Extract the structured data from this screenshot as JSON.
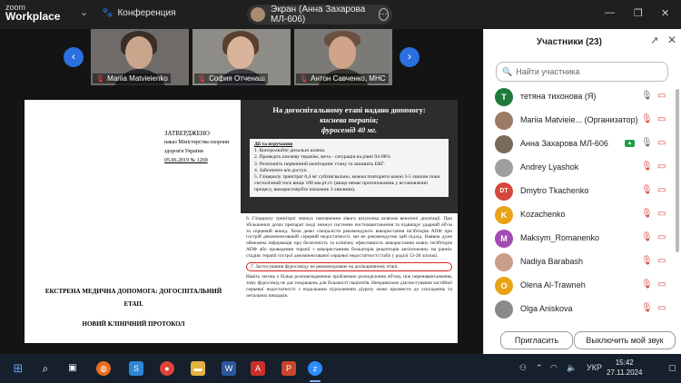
{
  "app": {
    "zoom_label": "zoom",
    "title": "Workplace",
    "meeting_name": "Конференция",
    "screen_share_label": "Экран (Анна Захарова МЛ-606)"
  },
  "icons": {
    "meeting": "paw-icon",
    "mic_off": "mic-off-icon",
    "video_off": "video-off-icon"
  },
  "colors": {
    "accent": "#2b6fe0",
    "mic_off": "#d6453c",
    "active_speaker": "#1f9e4a"
  },
  "video_strip": [
    {
      "name": "Mariia Matvieienko"
    },
    {
      "name": "София Отченаш"
    },
    {
      "name": "Антон Савченко, МНС"
    }
  ],
  "document": {
    "approve_heading": "ЗАТВЕРДЖЕНО",
    "approve_line1": "наказ Міністерства охорони",
    "approve_line2": "здоров'я України",
    "approve_date": "05.06.2019 № 1269",
    "title_line1": "ЕКСТРЕНА МЕДИЧНА ДОПОМОГА: ДОГОСПІТАЛЬНИЙ ЕТАП.",
    "title_line2": "НОВИЙ КЛІНІЧНИЙ ПРОТОКОЛ",
    "slide_heading1": "На догоспітальному етапі надано допомогу:",
    "slide_heading2": "киснева терапія;",
    "slide_heading3": "фуросемід 40 мг.",
    "steps_title": "Дії та втручання",
    "step1": "1. Контролюйте дихальні шляхи.",
    "step2": "2. Проведіть кисневу терапію, мета - сатурація на рівні 94-98%",
    "step3": "3. Розпочніть первинний моніторинг стану та запишіть ЕКГ.",
    "step4": "4. Забезпечте в/в доступ.",
    "step5": "5. Гліцерилу тринітрат 0,4 мг сублінгвально, можна повторити кожні 3-5 хвилин поки систолічний тиск вище 100 мм.рт.ст. (якщо немає протипоказань у встановленні процесу, використовуйте показник 3 хвилини).",
    "para6": "6. Гліцерилу тринітрат знижує наповнення лівого шлуночка шляхом венозної дилатації. При збільшених дозах препарат іноді знижує системне постнавантаження та підвищує ударний об'єм та серцевий викид. Хоча деякі спеціалісти рекомендують використання інгібіторів АПФ при гострій декомпенсованій серцевій недостатності, ми не рекомендуємо цей підхід. Наявна дуже обмежена інформація про безпечність та клінічну ефективність використання нових інгібіторів АПФ або проведення терапії з використанням блокаторів рецепторів ангіотензину на ранніх стадіях терапії гострої декомпенсованої серцевої недостатності (табл у роділі 12-28 ліплок).",
    "para7": "7. Застосування фуросеміду не рекомендоване на долікарняному етапі.",
    "para7b": "Навіть легень є більш розповсюдженою проблемою розподілення об'єму, ніж перенавантаження, тому фуросемід не дає покращень для більшості пацієнтів. Неправильне діагностування застійної серцевої недостатності з подальшим підсиленням діурезу може призвести до ускладнень та летальних випадків."
  },
  "participants": {
    "title": "Участники (23)",
    "search_placeholder": "Найти участника",
    "list": [
      {
        "initial": "T",
        "color": "#1f7a3d",
        "name": "тетяна тихонова (Я)",
        "mic_icon": "mic-icon",
        "video_icon": "video-off-icon"
      },
      {
        "initial": "",
        "color": "#9b7b66",
        "name": "Mariia Matvieie... (Организатор)",
        "mic_icon": "mic-off-icon",
        "video_icon": "video-off-icon"
      },
      {
        "initial": "",
        "color": "#7a6a5c",
        "name": "Анна Захарова МЛ-606",
        "mic_icon": "mic-icon",
        "video_icon": "video-off-icon",
        "share_icon": "screen-share-icon"
      },
      {
        "initial": "",
        "color": "#9e9e9e",
        "name": "Andrey Lyashok",
        "mic_icon": "mic-off-icon",
        "video_icon": "video-off-icon"
      },
      {
        "initial": "DT",
        "color": "#d5483c",
        "name": "Dmytro Tkachenko",
        "mic_icon": "mic-off-icon",
        "video_icon": "video-off-icon"
      },
      {
        "initial": "K",
        "color": "#e8a317",
        "name": "Kozachenko",
        "mic_icon": "mic-off-icon",
        "video_icon": "video-off-icon"
      },
      {
        "initial": "M",
        "color": "#a34ab3",
        "name": "Maksym_Romanenko",
        "mic_icon": "mic-off-icon",
        "video_icon": "video-off-icon"
      },
      {
        "initial": "",
        "color": "#c89e8a",
        "name": "Nadiya Barabash",
        "mic_icon": "mic-off-icon",
        "video_icon": "video-off-icon"
      },
      {
        "initial": "O",
        "color": "#e8a317",
        "name": "Olena Al-Trawneh",
        "mic_icon": "mic-off-icon",
        "video_icon": "video-off-icon"
      },
      {
        "initial": "",
        "color": "#8a8a8a",
        "name": "Olga Aniskova",
        "mic_icon": "mic-off-icon",
        "video_icon": "video-off-icon"
      }
    ],
    "invite_button": "Пригласить",
    "mute_button": "Выключить мой звук"
  },
  "taskbar": {
    "language": "УКР",
    "time": "15:42",
    "date": "27.11.2024"
  }
}
